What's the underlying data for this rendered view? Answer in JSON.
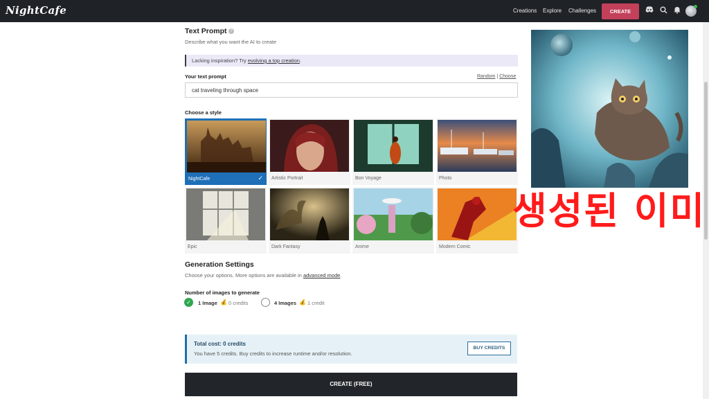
{
  "nav": {
    "logo": "NightCafe",
    "links": [
      "Creations",
      "Explore",
      "Challenges"
    ],
    "create_label": "CREATE",
    "icons": [
      "discord-icon",
      "search-icon",
      "bell-icon",
      "avatar"
    ]
  },
  "prompt_section": {
    "title": "Text Prompt",
    "help": "?",
    "description": "Describe what you want the AI to create",
    "banner_prefix": "Lacking inspiration? Try ",
    "banner_link": "evolving a top creation",
    "banner_suffix": ".",
    "label": "Your text prompt",
    "random": "Random",
    "separator": "|",
    "choose": "Choose",
    "value": "cat traveling through space"
  },
  "style_section": {
    "title": "Choose a style",
    "styles": [
      {
        "name": "NightCafe",
        "selected": true
      },
      {
        "name": "Artistic Portrait",
        "selected": false
      },
      {
        "name": "Bon Voyage",
        "selected": false
      },
      {
        "name": "Photo",
        "selected": false
      },
      {
        "name": "Epic",
        "selected": false
      },
      {
        "name": "Dark Fantasy",
        "selected": false
      },
      {
        "name": "Anime",
        "selected": false
      },
      {
        "name": "Modern Comic",
        "selected": false
      }
    ]
  },
  "generation": {
    "title": "Generation Settings",
    "description_prefix": "Choose your options. More options are available in ",
    "description_link": "advanced mode",
    "description_suffix": ".",
    "count_label": "Number of images to generate",
    "options": [
      {
        "label": "1 Image",
        "cost": "0 credits",
        "selected": true
      },
      {
        "label": "4 Images",
        "cost": "1 credit",
        "selected": false
      }
    ]
  },
  "cost": {
    "title": "Total cost: 0 credits",
    "text": "You have 5 credits. Buy credits to increase runtime and/or resolution.",
    "buy_label": "BUY CREDITS"
  },
  "create_free_label": "CREATE (FREE)",
  "overlay_caption": "생성된 이미지",
  "colors": {
    "topbar": "#1f2226",
    "create_button": "#c2405a",
    "selected_style": "#1e6fb8",
    "banner_bg": "#ebe8f8",
    "cost_bg": "#e6f1f7",
    "overlay_text": "#ff1b1b"
  }
}
